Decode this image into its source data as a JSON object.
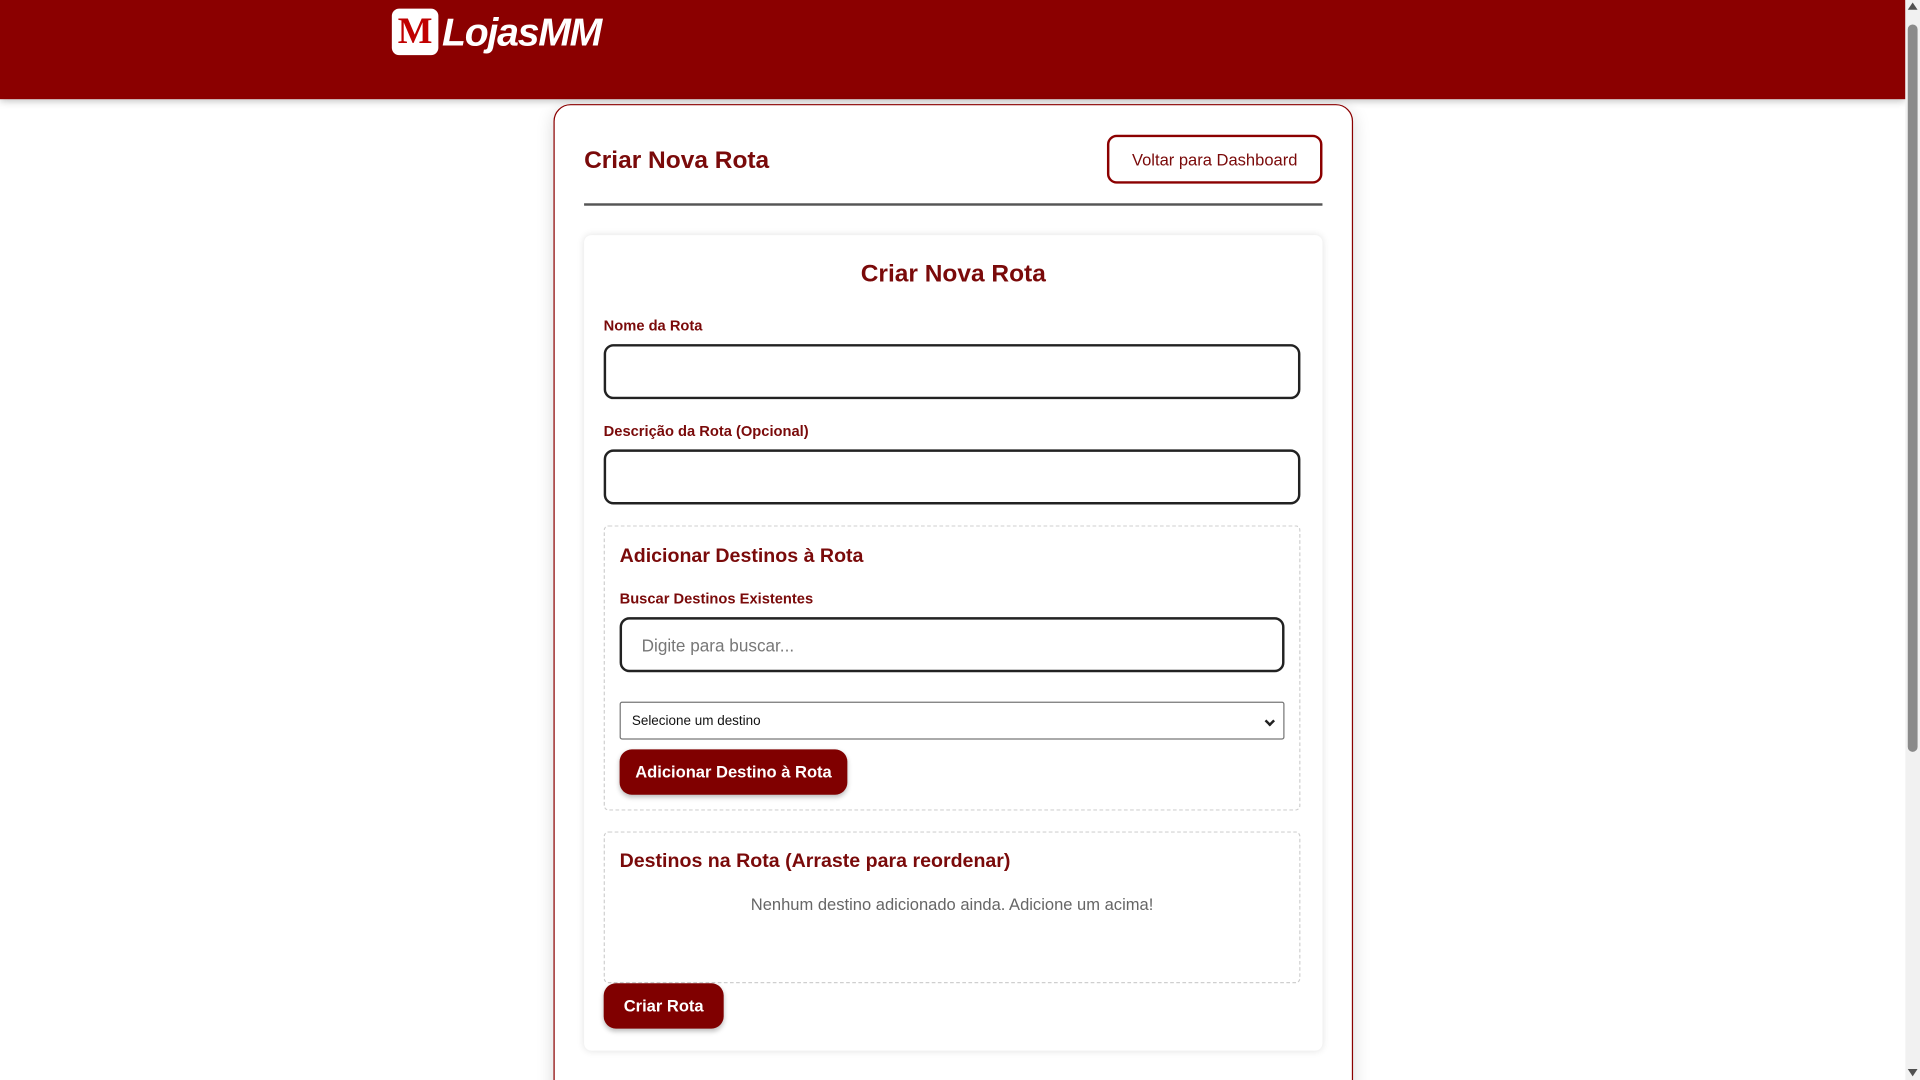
{
  "header": {
    "logo_mark": "M",
    "logo_text": "LojasMM",
    "brand_color": "#8b0000"
  },
  "page": {
    "title": "Criar Nova Rota",
    "back_button": "Voltar para Dashboard"
  },
  "form": {
    "title": "Criar Nova Rota",
    "route_name_label": "Nome da Rota",
    "route_name_value": "",
    "route_desc_label": "Descrição da Rota (Opcional)",
    "route_desc_value": "",
    "add_section": {
      "title": "Adicionar Destinos à Rota",
      "search_label": "Buscar Destinos Existentes",
      "search_placeholder": "Digite para buscar...",
      "select_value": "Selecione um destino",
      "add_button": "Adicionar Destino à Rota"
    },
    "list_section": {
      "title": "Destinos na Rota (Arraste para reordenar)",
      "empty_message": "Nenhum destino adicionado ainda. Adicione um acima!"
    },
    "submit_button": "Criar Rota"
  }
}
